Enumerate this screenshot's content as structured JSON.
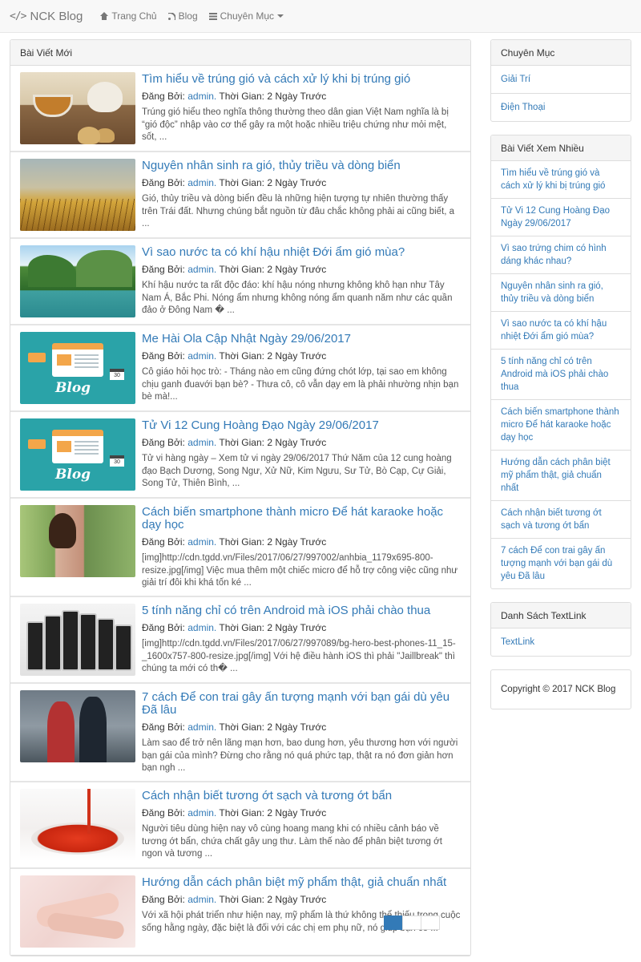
{
  "nav": {
    "brand": "NCK Blog",
    "home": "Trang Chủ",
    "blog": "Blog",
    "categories": "Chuyên Mục"
  },
  "main": {
    "heading": "Bài Viết Mới",
    "author_label": "Đăng Bởi:",
    "time_label": "Thời Gian:",
    "posts": [
      {
        "title": "Tìm hiểu về trúng gió và cách xử lý khi bị trúng gió",
        "author": "admin.",
        "time": "2 Ngày Trước",
        "excerpt": "Trúng gió hiểu theo nghĩa thông thường theo dân gian Việt Nam nghĩa là bị “gió độc” nhập vào cơ thể gây ra một hoặc nhiều triệu chứng như mỏi mệt, sốt, ..."
      },
      {
        "title": "Nguyên nhân sinh ra gió, thủy triều và dòng biển",
        "author": "admin.",
        "time": "2 Ngày Trước",
        "excerpt": "Gió, thủy triều và dòng biển đều là những hiện tượng tự nhiên thường thấy trên Trái đất. Nhưng chúng bắt nguồn từ đâu chắc không phải ai cũng biết, a ..."
      },
      {
        "title": "Vì sao nước ta có khí hậu nhiệt Đới ẩm gió mùa?",
        "author": "admin.",
        "time": "2 Ngày Trước",
        "excerpt": "Khí hậu nước ta rất độc đáo: khí hậu nóng nhưng không khô hạn như Tây Nam Á, Bắc Phi. Nóng ẩm nhưng không nóng ẩm quanh năm như các quần đảo ở Đông Nam � ..."
      },
      {
        "title": "Me Hài Ola Cập Nhật Ngày 29/06/2017",
        "author": "admin.",
        "time": "2 Ngày Trước",
        "excerpt": "Cô giáo hỏi học trò: - Tháng nào em cũng đứng chót lớp, tại sao em không chịu ganh đuavới bạn bè? - Thưa cô, cô vẫn dạy em là phải nhường nhịn bạn bè mà!..."
      },
      {
        "title": "Tử Vi 12 Cung Hoàng Đạo Ngày 29/06/2017",
        "author": "admin.",
        "time": "2 Ngày Trước",
        "excerpt": "Tử vi hàng ngày – Xem tử vi ngày 29/06/2017 Thứ Năm của 12 cung hoàng đạo Bạch Dương, Song Ngư, Xử Nữ, Kim Ngưu, Sư Tử, Bò Cạp, Cự Giải, Song Tử, Thiên Bình, ..."
      },
      {
        "title": "Cách biến smartphone thành micro Để hát karaoke hoặc dạy học",
        "author": "admin.",
        "time": "2 Ngày Trước",
        "excerpt": "[img]http://cdn.tgdd.vn/Files/2017/06/27/997002/anhbia_1179x695-800-resize.jpg[/img] Việc mua thêm một chiếc micro để hỗ trợ công việc cũng như giải trí đôi khi khá tốn ké ..."
      },
      {
        "title": "5 tính năng chỉ có trên Android mà iOS phải chào thua",
        "author": "admin.",
        "time": "2 Ngày Trước",
        "excerpt": "[img]http://cdn.tgdd.vn/Files/2017/06/27/997089/bg-hero-best-phones-11_15-_1600x757-800-resize.jpg[/img] Với hệ điều hành iOS thì phải \"Jaillbreak\" thì chúng ta mới có th� ..."
      },
      {
        "title": "7 cách Để con trai gây ấn tượng mạnh với bạn gái dù yêu Đã lâu",
        "author": "admin.",
        "time": "2 Ngày Trước",
        "excerpt": "Làm sao để trở nên lãng mạn hơn, bao dung hơn, yêu thương hơn với người bạn gái của mình? Đừng cho rằng nó quá phức tạp, thật ra nó đơn giản hơn bạn ngh ..."
      },
      {
        "title": "Cách nhận biết tương ớt sạch và tương ớt bẩn",
        "author": "admin.",
        "time": "2 Ngày Trước",
        "excerpt": "Người tiêu dùng hiện nay vô cùng hoang mang khi có nhiều cảnh báo về tương ớt bẩn, chứa chất gây ung thư. Làm thế nào để phân biệt tương ớt ngon và tương ..."
      },
      {
        "title": "Hướng dẫn cách phân biệt mỹ phẩm thật, giả chuẩn nhất",
        "author": "admin.",
        "time": "2 Ngày Trước",
        "excerpt": "Với xã hội phát triển như hiện nay, mỹ phẩm là thứ không thể thiếu trong cuộc sống hằng ngày, đặc biệt là đối với các chị em phụ nữ, nó giúp bạn có ..."
      }
    ],
    "blog_thumb_word": "Blog",
    "blog_thumb_cal": "30"
  },
  "sidebar": {
    "categories_heading": "Chuyên Mục",
    "categories": [
      "Giải Trí",
      "Điện Thoại"
    ],
    "popular_heading": "Bài Viết Xem Nhiều",
    "popular": [
      "Tìm hiểu về trúng gió và cách xử lý khi bị trúng gió",
      "Tử Vi 12 Cung Hoàng Đạo Ngày 29/06/2017",
      "Vì sao trứng chim có hình dáng khác nhau?",
      "Nguyên nhân sinh ra gió, thủy triều và dòng biển",
      "Vì sao nước ta có khí hậu nhiệt Đới ẩm gió mùa?",
      "5 tính năng chỉ có trên Android mà iOS phải chào thua",
      "Cách biến smartphone thành micro Để hát karaoke hoặc dạy học",
      "Hướng dẫn cách phân biệt mỹ phẩm thật, giả chuẩn nhất",
      "Cách nhận biết tương ớt sạch và tương ớt bẩn",
      "7 cách Để con trai gây ấn tượng mạnh với bạn gái dù yêu Đã lâu"
    ],
    "textlink_heading": "Danh Sách TextLink",
    "textlink": "TextLink",
    "copyright": "Copyright © 2017 NCK Blog"
  },
  "colors": {
    "link": "#337ab7",
    "panel_heading_bg": "#f5f5f5",
    "navbar_bg": "#f8f8f8"
  }
}
